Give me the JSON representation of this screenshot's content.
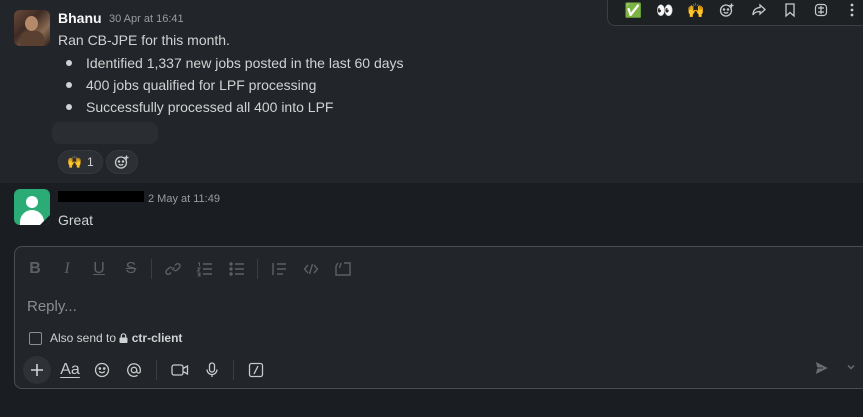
{
  "toolbar": {
    "items": [
      {
        "icon": "check-mark-emoji",
        "glyph": "✅"
      },
      {
        "icon": "eyes-emoji",
        "glyph": "👀"
      },
      {
        "icon": "raised-hands-emoji",
        "glyph": "🙌"
      },
      {
        "icon": "add-reaction-icon"
      },
      {
        "icon": "share-forward-icon"
      },
      {
        "icon": "bookmark-icon"
      },
      {
        "icon": "app-shortcut-icon"
      },
      {
        "icon": "more-vertical-icon"
      }
    ]
  },
  "messages": [
    {
      "author": "Bhanu",
      "timestamp": "30 Apr at 16:41",
      "text": "Ran CB-JPE for this month.",
      "bullets": [
        "Identified 1,337 new jobs posted in the last 60 days",
        "400 jobs qualified for LPF processing",
        "Successfully processed all 400 into LPF"
      ],
      "reaction": {
        "emoji": "🙌",
        "count": "1"
      }
    },
    {
      "author": "",
      "timestamp": "2 May at 11:49",
      "text": "Great"
    }
  ],
  "composer": {
    "placeholder": "Reply...",
    "also_send_label": "Also send to",
    "channel": "ctr-client",
    "format_buttons": [
      "bold-icon",
      "italic-icon",
      "underline-icon",
      "strikethrough-icon",
      "link-icon",
      "ordered-list-icon",
      "bulleted-list-icon",
      "blockquote-icon",
      "code-icon",
      "code-block-icon"
    ],
    "bottom_buttons": [
      "plus-icon",
      "text-format-icon",
      "emoji-icon",
      "mention-icon",
      "video-icon",
      "microphone-icon",
      "slash-command-icon"
    ],
    "format_labels": {
      "bold": "B",
      "italic": "I",
      "underline": "U",
      "strike": "S",
      "text": "Aa"
    }
  }
}
